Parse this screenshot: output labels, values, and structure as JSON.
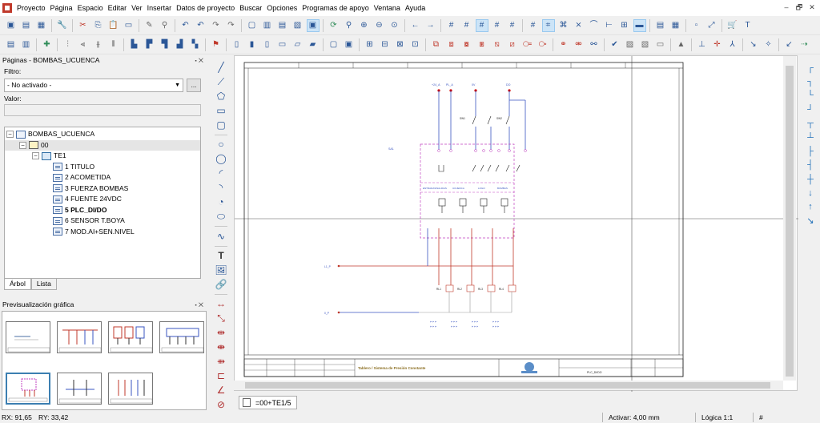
{
  "menu": [
    "Proyecto",
    "Página",
    "Espacio",
    "Editar",
    "Ver",
    "Insertar",
    "Datos de proyecto",
    "Buscar",
    "Opciones",
    "Programas de apoyo",
    "Ventana",
    "Ayuda"
  ],
  "window_controls": {
    "minimize": "–",
    "restore": "🗗",
    "close": "✕"
  },
  "pages_panel": {
    "title": "Páginas - BOMBAS_UCUENCA",
    "close": "⬝ ✕",
    "filter_label": "Filtro:",
    "filter_value": "- No activado -",
    "more_button": "...",
    "value_label": "Valor:",
    "tree": {
      "project": "BOMBAS_UCUENCA",
      "level1": "00",
      "level2": "TE1",
      "pages": [
        "1 TITULO",
        "2 ACOMETIDA",
        "3 FUERZA BOMBAS",
        "4 FUENTE 24VDC",
        "5 PLC_DI/DO",
        "6 SENSOR T.BOYA",
        "7 MOD.AI+SEN.NIVEL"
      ]
    },
    "tabs": [
      "Árbol",
      "Lista"
    ]
  },
  "preview_panel": {
    "title": "Previsualización gráfica",
    "close": "⬝ ✕"
  },
  "drawing": {
    "top_labels": [
      "+24_A",
      "PL_A",
      "0V",
      "DO"
    ],
    "module_label": "SA1",
    "groups": [
      "ENTRADAS/SALIDAS",
      "UCUENCA",
      "LOGO",
      "BOMBAS"
    ],
    "relays": [
      "RL1",
      "RL2",
      "RL3",
      "RL4"
    ],
    "wire_left_1": "L1_P",
    "wire_left_2": "0_P",
    "titleblock_title": "Tablero / Sistema de Presión Constante",
    "titleblock_code": "PLC_DI/DO"
  },
  "document_tab": "=00+TE1/5",
  "status": {
    "rx": "RX: 91,65",
    "ry": "RY: 33,42",
    "activate": "Activar: 4,00 mm",
    "logic": "Lógica 1:1",
    "hash": "#"
  }
}
